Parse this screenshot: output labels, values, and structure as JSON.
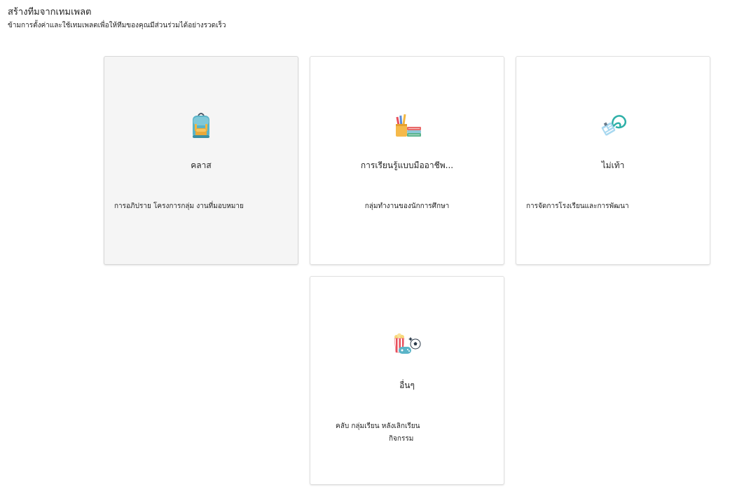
{
  "header": {
    "title": "สร้างทีมจากเทมเพลต",
    "subtitle": "ข้ามการตั้งค่าและใช้เทมเพลตเพื่อให้ทีมของคุณมีส่วนร่วมได้อย่างรวดเร็ว"
  },
  "cards": [
    {
      "title": "คลาส",
      "description": "การอภิปราย โครงการกลุ่ม งานที่มอบหมาย",
      "icon": "backpack-icon"
    },
    {
      "title": "การเรียนรู้แบบมืออาชีพ...",
      "description": "กลุ่มทำงานของนักการศึกษา",
      "icon": "pencils-books-icon"
    },
    {
      "title": "ไม่เท้า",
      "description": "การจัดการโรงเรียนและการพัฒนา",
      "icon": "id-badge-lanyard-icon"
    },
    {
      "title": "อื่นๆ",
      "description_line1": "คลับ กลุ่มเรียน หลังเลิกเรียน",
      "description_line2": "กิจกรรม",
      "icon": "popcorn-soccer-icon"
    }
  ]
}
